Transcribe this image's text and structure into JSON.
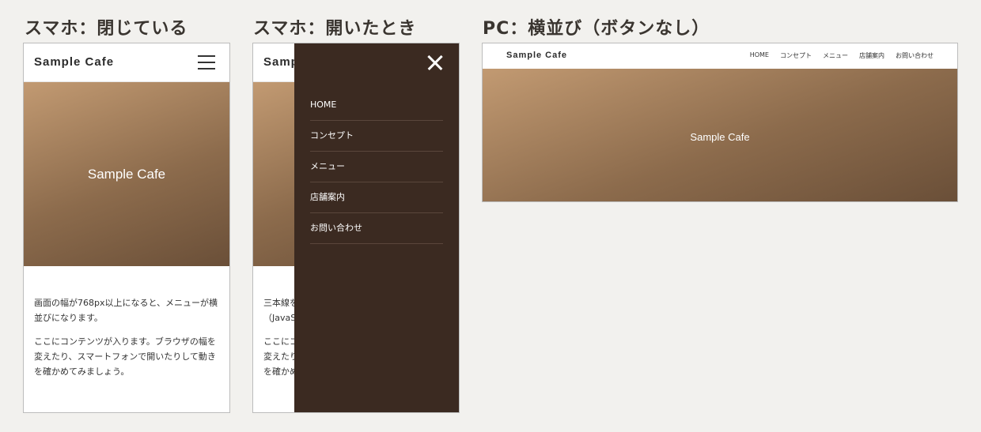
{
  "panels": {
    "closed_title": "スマホ：閉じている",
    "open_title": "スマホ：開いたとき",
    "pc_title": "PC：横並び（ボタンなし）"
  },
  "brand": "Sample Cafe",
  "hero_text": "Sample Cafe",
  "closed_body": [
    "画面の幅が768px以上になると、メニューが横並びになります。",
    "ここにコンテンツが入ります。ブラウザの幅を変えたり、スマートフォンで開いたりして動きを確かめてみましょう。"
  ],
  "open_body": {
    "line1": "三本線を",
    "line2": "（JavaS",
    "line3": "ここにコ",
    "line4": "変えたり",
    "line5": "を確かめ",
    "brand_partial": "Samp"
  },
  "menu": [
    "HOME",
    "コンセプト",
    "メニュー",
    "店舗案内",
    "お問い合わせ"
  ],
  "icons": {
    "menu": "hamburger-icon",
    "close": "close-icon"
  },
  "colors": {
    "drawer": "#3b2a21",
    "hero": "#9c7a58"
  }
}
